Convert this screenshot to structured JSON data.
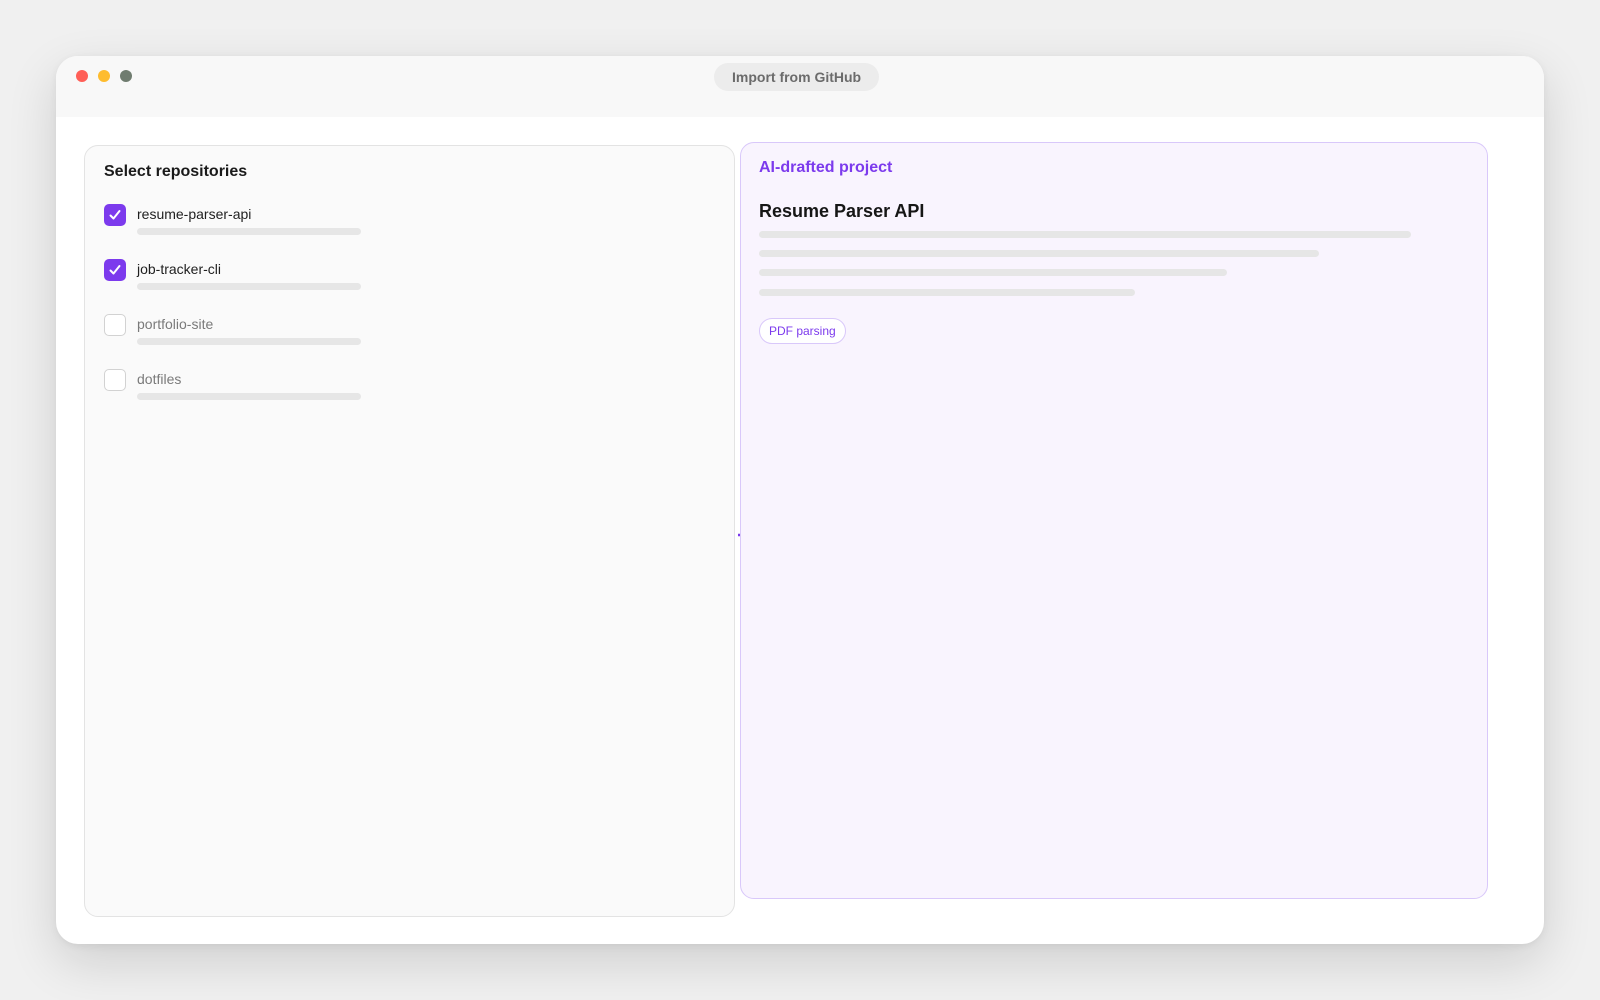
{
  "window": {
    "title": "Import from GitHub"
  },
  "repos": {
    "heading": "Select repositories",
    "items": [
      {
        "name": "resume-parser-api",
        "checked": true
      },
      {
        "name": "job-tracker-cli",
        "checked": true
      },
      {
        "name": "portfolio-site",
        "checked": false
      },
      {
        "name": "dotfiles",
        "checked": false
      }
    ]
  },
  "draft": {
    "label": "AI-drafted project",
    "project_title": "Resume Parser API",
    "tag": "PDF parsing"
  },
  "colors": {
    "accent": "#7c3aed",
    "draft_background": "#f9f4fe",
    "draft_border": "#d9c8fa"
  },
  "icons": {
    "checkbox_checked": "check-icon",
    "flow_arrow": "arrow-right-icon"
  }
}
